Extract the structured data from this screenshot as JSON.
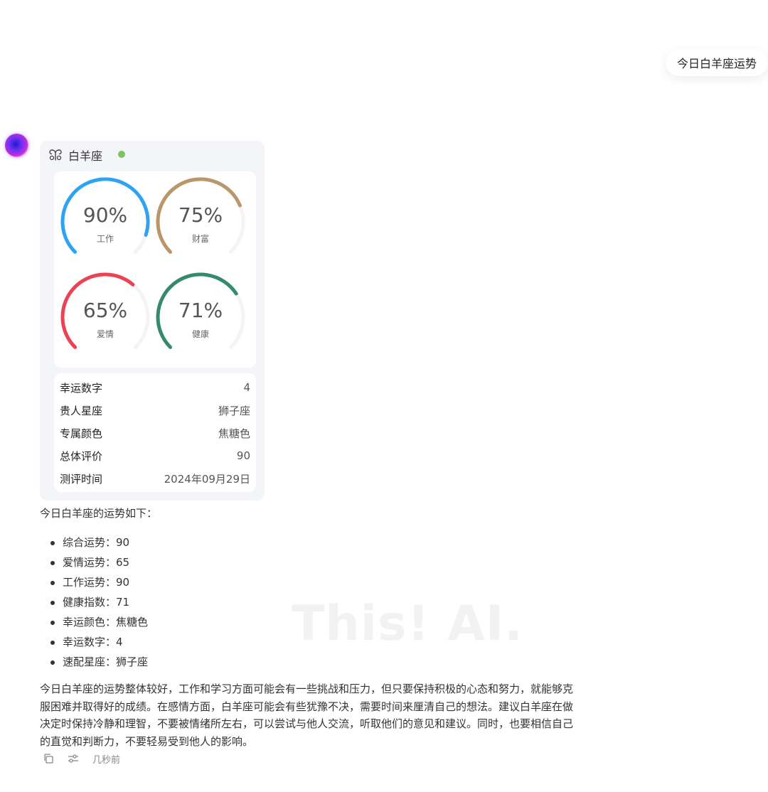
{
  "user_message": "今日白羊座运势",
  "watermark": "This! AI.",
  "card": {
    "sign_name": "白羊座",
    "status_color": "#7ec360",
    "gauges": [
      {
        "label": "工作",
        "value_text": "90%",
        "value": 0.9,
        "color": "#2ea3f2"
      },
      {
        "label": "财富",
        "value_text": "75%",
        "value": 0.75,
        "color": "#b8976a"
      },
      {
        "label": "爱情",
        "value_text": "65%",
        "value": 0.65,
        "color": "#ec4256"
      },
      {
        "label": "健康",
        "value_text": "71%",
        "value": 0.71,
        "color": "#358a6c"
      }
    ],
    "track_color": "#f3f3f8",
    "info": [
      {
        "key": "幸运数字",
        "value": "4"
      },
      {
        "key": "贵人星座",
        "value": "狮子座"
      },
      {
        "key": "专属颜色",
        "value": "焦糖色"
      },
      {
        "key": "总体评价",
        "value": "90"
      },
      {
        "key": "测评时间",
        "value": "2024年09月29日"
      }
    ]
  },
  "reply": {
    "intro": "今日白羊座的运势如下：",
    "bullets": [
      "综合运势：90",
      "爱情运势：65",
      "工作运势：90",
      "健康指数：71",
      "幸运颜色：焦糖色",
      "幸运数字：4",
      "速配星座：狮子座"
    ],
    "paragraph": "今日白羊座的运势整体较好，工作和学习方面可能会有一些挑战和压力，但只要保持积极的心态和努力，就能够克服困难并取得好的成绩。在感情方面，白羊座可能会有些犹豫不决，需要时间来厘清自己的想法。建议白羊座在做决定时保持冷静和理智，不要被情绪所左右，可以尝试与他人交流，听取他们的意见和建议。同时，也要相信自己的直觉和判断力，不要轻易受到他人的影响。"
  },
  "footer": {
    "icons": [
      "copy-icon",
      "settings-sliders-icon"
    ],
    "timestamp": "几秒前"
  }
}
